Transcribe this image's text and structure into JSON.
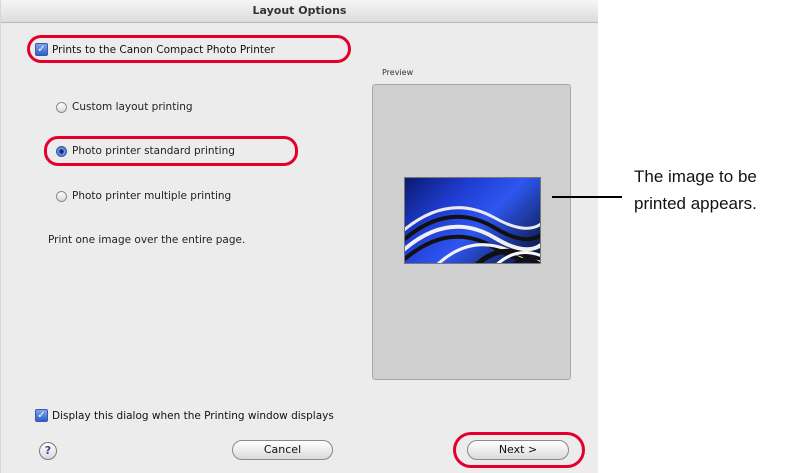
{
  "dialog": {
    "title": "Layout Options",
    "main_checkbox_label": "Prints to the Canon Compact Photo Printer",
    "radio_options": [
      "Custom layout printing",
      "Photo printer standard printing",
      "Photo printer multiple printing"
    ],
    "selected_option": "Photo printer standard printing",
    "description": "Print one image over the entire page.",
    "preview_label": "Preview",
    "display_dialog_label": "Display this dialog when the Printing window displays",
    "help_label": "?",
    "cancel_label": "Cancel",
    "next_label": "Next >"
  },
  "callout": {
    "line1": "The image to be",
    "line2": "printed appears."
  },
  "colors": {
    "highlight": "#e4002b",
    "accent": "#2f5fc8"
  }
}
